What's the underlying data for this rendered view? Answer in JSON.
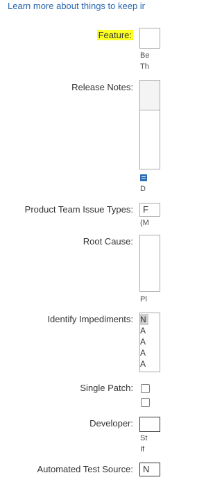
{
  "header": {
    "link_text": "Learn more about things to keep ir"
  },
  "fields": {
    "feature": {
      "label": "Feature:",
      "help": [
        "Be",
        "Th"
      ]
    },
    "release_notes": {
      "label": "Release Notes:",
      "help": "D"
    },
    "product_team_issue_types": {
      "label": "Product Team Issue Types:",
      "value": "F",
      "help": "(M"
    },
    "root_cause": {
      "label": "Root Cause:",
      "help": "Pl"
    },
    "identify_impediments": {
      "label": "Identify Impediments:",
      "options": [
        "N",
        "A",
        "A",
        "A",
        "A"
      ]
    },
    "single_patch": {
      "label": "Single Patch:"
    },
    "developer": {
      "label": "Developer:",
      "help": [
        "St",
        "If"
      ]
    },
    "automated_test_source": {
      "label": "Automated Test Source:",
      "value": "N"
    }
  },
  "icons": {
    "editor_toolbar": "format-icon"
  },
  "colors": {
    "highlight": "#fbff22",
    "link": "#2a68b0",
    "selection": "#cfcfcf"
  }
}
